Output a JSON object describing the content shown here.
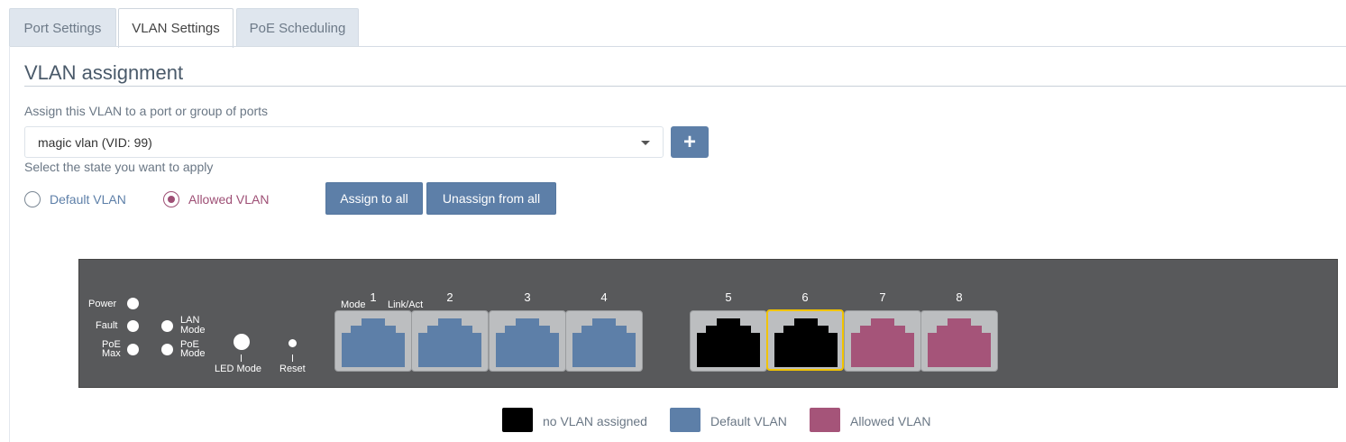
{
  "tabs": [
    {
      "label": "Port Settings",
      "active": false
    },
    {
      "label": "VLAN Settings",
      "active": true
    },
    {
      "label": "PoE Scheduling",
      "active": false
    }
  ],
  "section": {
    "title": "VLAN assignment",
    "assign_label": "Assign this VLAN to a port or group of ports",
    "state_label": "Select the state you want to apply"
  },
  "vlan_select": {
    "value": "magic vlan (VID: 99)"
  },
  "add_button": {
    "label": "+"
  },
  "state_options": [
    {
      "label": "Default VLAN",
      "checked": false
    },
    {
      "label": "Allowed VLAN",
      "checked": true
    }
  ],
  "actions": {
    "assign_all": "Assign to all",
    "unassign_all": "Unassign from all"
  },
  "switch": {
    "leds": {
      "power": "Power",
      "fault": "Fault",
      "poe_max_line1": "PoE",
      "poe_max_line2": "Max",
      "lan_mode_line1": "LAN",
      "lan_mode_line2": "Mode",
      "poe_mode_line1": "PoE",
      "poe_mode_line2": "Mode",
      "led_mode": "LED Mode",
      "reset": "Reset"
    },
    "port_header": {
      "mode": "Mode",
      "link_act": "Link/Act"
    },
    "ports": [
      {
        "number": "1",
        "state": "default"
      },
      {
        "number": "2",
        "state": "default"
      },
      {
        "number": "3",
        "state": "default"
      },
      {
        "number": "4",
        "state": "default"
      },
      {
        "number": "5",
        "state": "none"
      },
      {
        "number": "6",
        "state": "none",
        "selected": true
      },
      {
        "number": "7",
        "state": "allowed"
      },
      {
        "number": "8",
        "state": "allowed"
      }
    ]
  },
  "legend": [
    {
      "label": "no VLAN assigned",
      "color": "#000000"
    },
    {
      "label": "Default VLAN",
      "color": "#5d7fa8"
    },
    {
      "label": "Allowed VLAN",
      "color": "#a55479"
    }
  ],
  "colors": {
    "none": "#000000",
    "default": "#5d7fa8",
    "allowed": "#a55479",
    "selected_border": "#f2c400",
    "accent": "#5d7fa8"
  }
}
